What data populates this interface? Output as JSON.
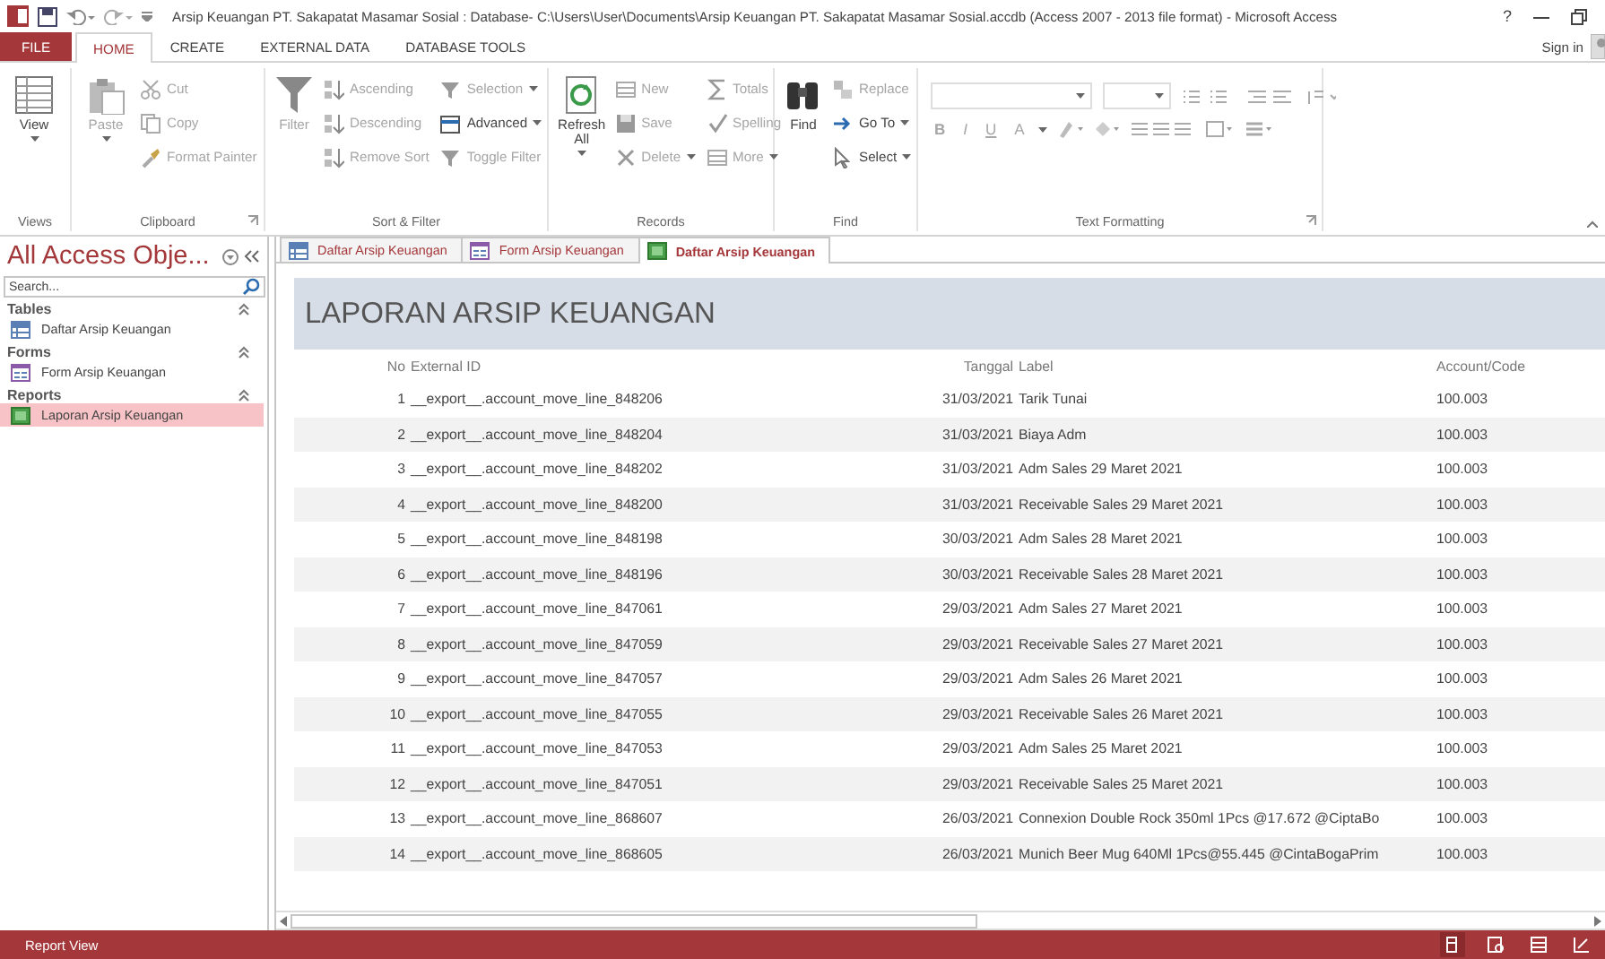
{
  "window": {
    "title": "Arsip Keuangan PT. Sakapatat Masamar Sosial : Database- C:\\Users\\User\\Documents\\Arsip Keuangan PT. Sakapatat Masamar Sosial.accdb (Access 2007 - 2013 file format) - Microsoft Access",
    "help": "?"
  },
  "ribbon_tabs": [
    {
      "label": "FILE",
      "kind": "file",
      "selected": false
    },
    {
      "label": "HOME",
      "kind": "tab",
      "selected": true
    },
    {
      "label": "CREATE",
      "kind": "tab",
      "selected": false
    },
    {
      "label": "EXTERNAL DATA",
      "kind": "tab",
      "selected": false
    },
    {
      "label": "DATABASE TOOLS",
      "kind": "tab",
      "selected": false
    }
  ],
  "sign_in": "Sign in",
  "ribbon_groups": [
    {
      "label": "Views",
      "commands": [
        {
          "label": "View",
          "kind": "large",
          "disabled": false,
          "dropdown": true
        }
      ]
    },
    {
      "label": "Clipboard",
      "launcher": true,
      "commands": [
        {
          "label": "Paste",
          "kind": "large",
          "disabled": true,
          "dropdown": true
        },
        {
          "label": "Cut",
          "kind": "small",
          "disabled": true
        },
        {
          "label": "Copy",
          "kind": "small",
          "disabled": true
        },
        {
          "label": "Format Painter",
          "kind": "small",
          "disabled": true
        }
      ]
    },
    {
      "label": "Sort & Filter",
      "commands": [
        {
          "label": "Filter",
          "kind": "large",
          "disabled": true
        },
        {
          "label": "Ascending",
          "kind": "small",
          "disabled": true
        },
        {
          "label": "Descending",
          "kind": "small",
          "disabled": true
        },
        {
          "label": "Remove Sort",
          "kind": "small",
          "disabled": true
        },
        {
          "label": "Selection",
          "kind": "small",
          "disabled": true,
          "dropdown": true
        },
        {
          "label": "Advanced",
          "kind": "small",
          "disabled": false,
          "dropdown": true
        },
        {
          "label": "Toggle Filter",
          "kind": "small",
          "disabled": true
        }
      ]
    },
    {
      "label": "Records",
      "commands": [
        {
          "label": "Refresh All",
          "kind": "large",
          "disabled": false,
          "dropdown": true
        },
        {
          "label": "New",
          "kind": "small",
          "disabled": true
        },
        {
          "label": "Save",
          "kind": "small",
          "disabled": true
        },
        {
          "label": "Delete",
          "kind": "small",
          "disabled": true,
          "dropdown": true
        },
        {
          "label": "Totals",
          "kind": "small",
          "disabled": true
        },
        {
          "label": "Spelling",
          "kind": "small",
          "disabled": true
        },
        {
          "label": "More",
          "kind": "small",
          "disabled": true,
          "dropdown": true
        }
      ]
    },
    {
      "label": "Find",
      "commands": [
        {
          "label": "Find",
          "kind": "large",
          "disabled": false
        },
        {
          "label": "Replace",
          "kind": "small",
          "disabled": true
        },
        {
          "label": "Go To",
          "kind": "small",
          "disabled": false,
          "dropdown": true
        },
        {
          "label": "Select",
          "kind": "small",
          "disabled": false,
          "dropdown": true
        }
      ]
    },
    {
      "label": "Text Formatting",
      "launcher": true,
      "commands": [
        {
          "label": "B",
          "kind": "format",
          "disabled": true
        },
        {
          "label": "I",
          "kind": "format",
          "disabled": true
        },
        {
          "label": "U",
          "kind": "format",
          "disabled": true
        },
        {
          "label": "A",
          "kind": "format",
          "disabled": true,
          "dropdown": true
        }
      ]
    }
  ],
  "nav_pane": {
    "title": "All Access Obje...",
    "search": {
      "placeholder": "Search..."
    },
    "groups": [
      {
        "name": "Tables",
        "kind": "table",
        "items": [
          {
            "label": "Daftar Arsip Keuangan",
            "selected": false
          }
        ]
      },
      {
        "name": "Forms",
        "kind": "form",
        "items": [
          {
            "label": "Form Arsip Keuangan",
            "selected": false
          }
        ]
      },
      {
        "name": "Reports",
        "kind": "report",
        "items": [
          {
            "label": "Laporan Arsip Keuangan",
            "selected": true
          }
        ]
      }
    ]
  },
  "doc_tabs": [
    {
      "label": "Daftar Arsip Keuangan",
      "kind": "table",
      "selected": false
    },
    {
      "label": "Form Arsip Keuangan",
      "kind": "form",
      "selected": false
    },
    {
      "label": "Daftar Arsip Keuangan",
      "kind": "report",
      "selected": true
    }
  ],
  "report": {
    "title": "LAPORAN ARSIP KEUANGAN",
    "columns": [
      "No",
      "External ID",
      "Tanggal",
      "Label",
      "Account/Code"
    ],
    "rows": [
      [
        "1",
        "__export__.account_move_line_848206",
        "31/03/2021",
        "Tarik Tunai",
        "100.003"
      ],
      [
        "2",
        "__export__.account_move_line_848204",
        "31/03/2021",
        "Biaya Adm",
        "100.003"
      ],
      [
        "3",
        "__export__.account_move_line_848202",
        "31/03/2021",
        "Adm Sales 29 Maret 2021",
        "100.003"
      ],
      [
        "4",
        "__export__.account_move_line_848200",
        "31/03/2021",
        "Receivable Sales 29 Maret 2021",
        "100.003"
      ],
      [
        "5",
        "__export__.account_move_line_848198",
        "30/03/2021",
        "Adm Sales 28 Maret 2021",
        "100.003"
      ],
      [
        "6",
        "__export__.account_move_line_848196",
        "30/03/2021",
        "Receivable Sales 28 Maret 2021",
        "100.003"
      ],
      [
        "7",
        "__export__.account_move_line_847061",
        "29/03/2021",
        "Adm Sales 27 Maret 2021",
        "100.003"
      ],
      [
        "8",
        "__export__.account_move_line_847059",
        "29/03/2021",
        "Receivable Sales 27 Maret 2021",
        "100.003"
      ],
      [
        "9",
        "__export__.account_move_line_847057",
        "29/03/2021",
        "Adm Sales 26 Maret 2021",
        "100.003"
      ],
      [
        "10",
        "__export__.account_move_line_847055",
        "29/03/2021",
        "Receivable Sales 26 Maret 2021",
        "100.003"
      ],
      [
        "11",
        "__export__.account_move_line_847053",
        "29/03/2021",
        "Adm Sales 25 Maret 2021",
        "100.003"
      ],
      [
        "12",
        "__export__.account_move_line_847051",
        "29/03/2021",
        "Receivable Sales 25 Maret 2021",
        "100.003"
      ],
      [
        "13",
        "__export__.account_move_line_868607",
        "26/03/2021",
        "Connexion Double Rock 350ml 1Pcs @17.672 @CiptaBo",
        "100.003"
      ],
      [
        "14",
        "__export__.account_move_line_868605",
        "26/03/2021",
        "Munich Beer Mug 640Ml 1Pcs@55.445 @CintaBogaPrim",
        "100.003"
      ]
    ]
  },
  "status_bar": {
    "text": "Report View"
  }
}
